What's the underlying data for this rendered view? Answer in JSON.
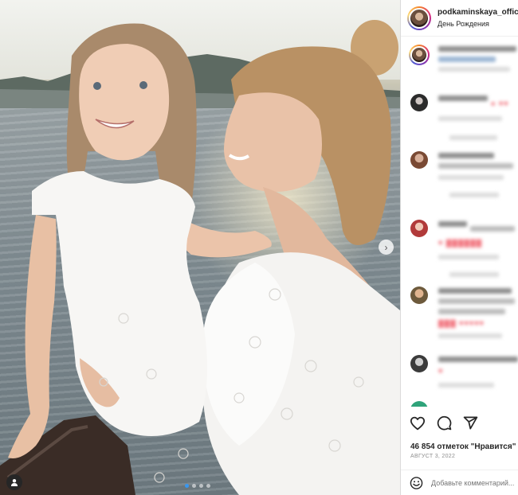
{
  "post": {
    "username": "podkaminskaya_official",
    "subtitle": "День Рождения",
    "likes": "46 854 отметок \"Нравится\"",
    "date": "АВГУСТ 3, 2022",
    "comment_placeholder": "Добавьте комментарий..."
  },
  "carousel": {
    "slide_count": 4,
    "active_index": 0
  },
  "colors": {
    "accent": "#3897f0",
    "like_red": "#ed4956",
    "text": "#262626",
    "muted": "#8e8e8e"
  },
  "icons": [
    "heart-icon",
    "comment-icon",
    "share-icon",
    "emoji-icon",
    "chevron-right-icon",
    "user-tag-icon"
  ]
}
